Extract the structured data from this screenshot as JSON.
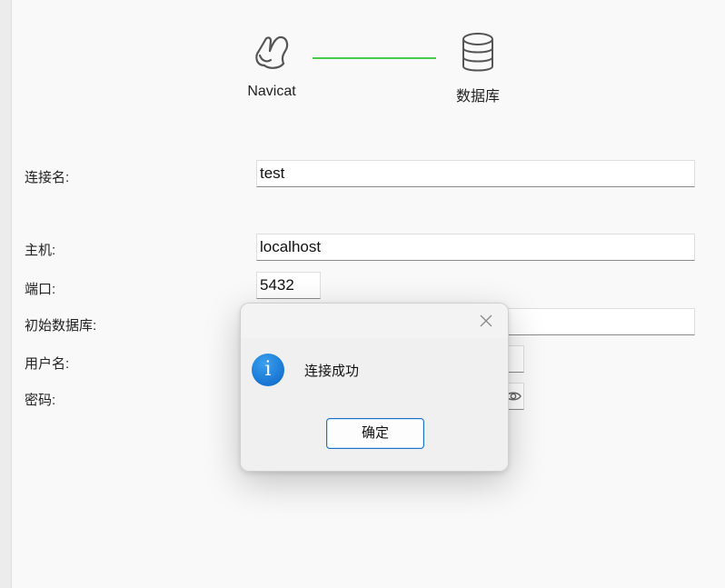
{
  "steps": [
    {
      "label": "Navicat",
      "icon": "navicat-logo-icon"
    },
    {
      "label": "数据库",
      "icon": "database-icon"
    }
  ],
  "colors": {
    "connector": "#4cc94c",
    "accent": "#1a73c9",
    "info_icon": "#0a63c4"
  },
  "form": {
    "connection_name": {
      "label": "连接名:",
      "value": "test"
    },
    "host": {
      "label": "主机:",
      "value": "localhost"
    },
    "port": {
      "label": "端口:",
      "value": "5432"
    },
    "initial_database": {
      "label": "初始数据库:",
      "value": ""
    },
    "username": {
      "label": "用户名:",
      "value": ""
    },
    "password": {
      "label": "密码:",
      "value": "",
      "toggle_icon": "eye-icon"
    }
  },
  "dialog": {
    "message": "连接成功",
    "icon": "info-icon",
    "info_glyph": "i",
    "ok_label": "确定",
    "close_icon": "close-icon"
  }
}
